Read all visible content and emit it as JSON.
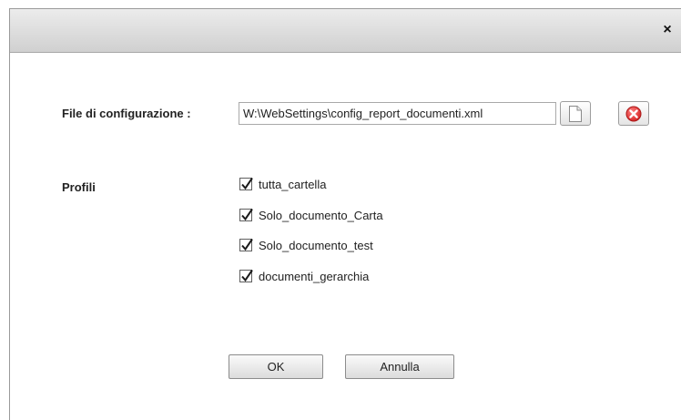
{
  "dialog": {
    "close_symbol": "×",
    "close_icon": "close-icon"
  },
  "config": {
    "label": "File di configurazione :",
    "value": "W:\\WebSettings\\config_report_documenti.xml",
    "new_icon": "document-icon",
    "clear_icon": "red-x-circle-icon",
    "accent_color": "#e03a3a"
  },
  "profiles": {
    "label": "Profili",
    "items": [
      {
        "label": "tutta_cartella",
        "checked": true
      },
      {
        "label": "Solo_documento_Carta",
        "checked": true
      },
      {
        "label": "Solo_documento_test",
        "checked": true
      },
      {
        "label": "documenti_gerarchia",
        "checked": true
      }
    ]
  },
  "buttons": {
    "ok": "OK",
    "cancel": "Annulla"
  }
}
